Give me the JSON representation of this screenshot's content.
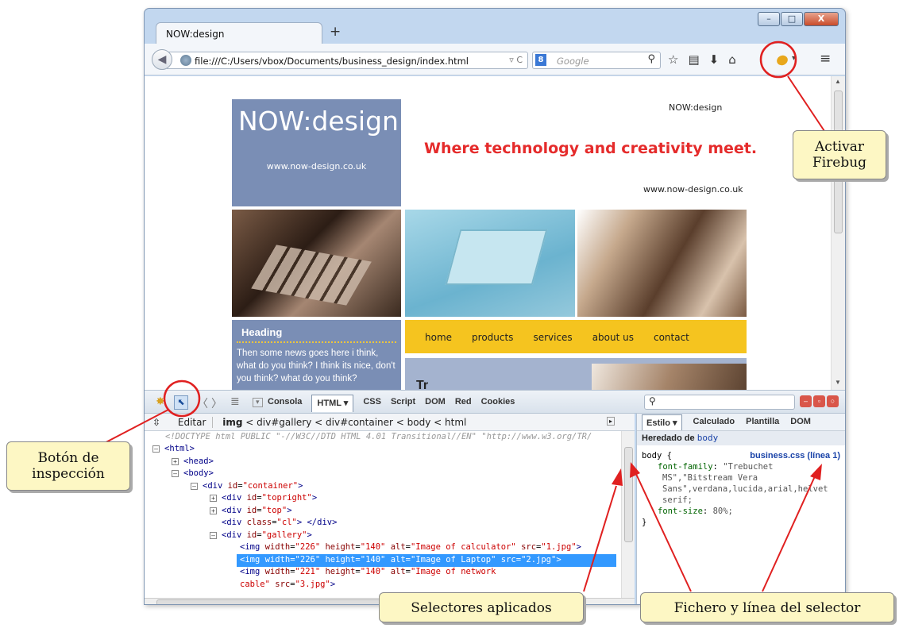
{
  "browser": {
    "tab_title": "NOW:design",
    "new_tab": "+",
    "url": "file:///C:/Users/vbox/Documents/business_design/index.html",
    "search_placeholder": "Google",
    "search_engine_badge": "8",
    "window_controls": {
      "minimize": "–",
      "maximize": "□",
      "close": "X"
    }
  },
  "page": {
    "logo_title": "NOW:design",
    "logo_url": "www.now-design.co.uk",
    "top_right": "NOW:design",
    "tagline": "Where technology and creativity meet.",
    "site_url": "www.now-design.co.uk",
    "sidebar_heading": "Heading",
    "sidebar_text": "Then some news goes here i think, what do you think? I think its nice, don't you think? what do you think?",
    "nav": [
      "home",
      "products",
      "services",
      "about us",
      "contact"
    ],
    "content_heading": "Tr"
  },
  "firebug": {
    "tabs": [
      "Consola",
      "HTML ▾",
      "CSS",
      "Script",
      "DOM",
      "Red",
      "Cookies"
    ],
    "selected_tab": "HTML ▾",
    "search_value": "",
    "breadcrumb": {
      "edit": "Editar",
      "current": "img",
      "path": "< div#gallery < div#container < body < html"
    },
    "html_lines": {
      "doctype": "<!DOCTYPE html PUBLIC \"-//W3C//DTD HTML 4.01 Transitional//EN\" \"http://www.w3.org/TR/",
      "html": "<html>",
      "head": "<head>",
      "body": "<body>",
      "container": "\"container\"",
      "topright": "\"topright\"",
      "top": "\"top\"",
      "cl": "\"cl\"",
      "gallery": "\"gallery\"",
      "img1_w": "\"226\"",
      "img1_h": "\"140\"",
      "img1_alt": "\"Image of calculator\"",
      "img1_src": "\"1.jpg\"",
      "img2_w": "\"226\"",
      "img2_h": "\"140\"",
      "img2_alt": "\"Image of Laptop\"",
      "img2_src": "\"2.jpg\"",
      "img3_w": "\"221\"",
      "img3_h": "\"140\"",
      "img3_alt": "\"Image of network",
      "img3_alt2": "cable\"",
      "img3_src": "\"3.jpg\""
    },
    "side_tabs": [
      "Estilo ▾",
      "Calculado",
      "Plantilla",
      "DOM"
    ],
    "inherited_label": "Heredado de",
    "inherited_from": "body",
    "rule_selector": "body {",
    "rule_file": "business.css (línea 1)",
    "ff_prop": "font-family",
    "ff_val1": "\"Trebuchet",
    "ff_val2": "MS\",\"Bitstream Vera",
    "ff_val3": "Sans\",verdana,lucida,arial,helvet",
    "ff_val4": "serif;",
    "fs_prop": "font-size",
    "fs_val": "80%;",
    "rule_close": "}"
  },
  "callouts": {
    "activar": "Activar Firebug",
    "inspeccion": "Botón de inspección",
    "selectores": "Selectores aplicados",
    "fichero": "Fichero y línea del selector"
  },
  "annotation_color": "#e02020"
}
